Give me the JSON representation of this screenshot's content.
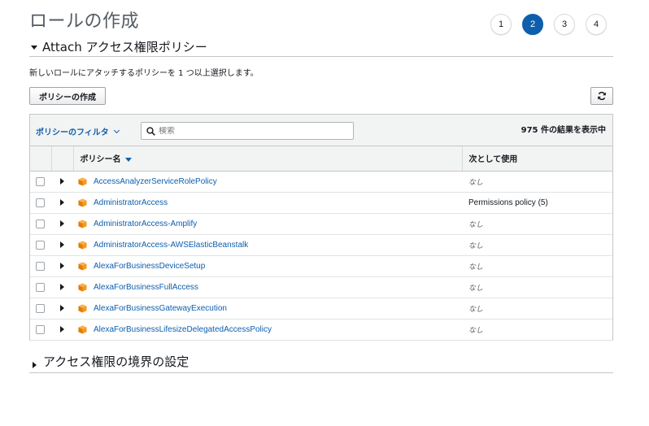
{
  "page": {
    "title": "ロールの作成",
    "steps": [
      "1",
      "2",
      "3",
      "4"
    ],
    "active_step": "2"
  },
  "section": {
    "title": "Attach アクセス権限ポリシー",
    "description": "新しいロールにアタッチするポリシーを 1 つ以上選択します。"
  },
  "toolbar": {
    "create_label": "ポリシーの作成"
  },
  "filter": {
    "label": "ポリシーのフィルタ",
    "search_placeholder": "検索",
    "result_count": "975 件の結果を表示中"
  },
  "table": {
    "headers": {
      "name": "ポリシー名",
      "used_as": "次として使用"
    },
    "rows": [
      {
        "name": "AccessAnalyzerServiceRolePolicy",
        "used_as": "なし"
      },
      {
        "name": "AdministratorAccess",
        "used_as": "Permissions policy (5)"
      },
      {
        "name": "AdministratorAccess-Amplify",
        "used_as": "なし"
      },
      {
        "name": "AdministratorAccess-AWSElasticBeanstalk",
        "used_as": "なし"
      },
      {
        "name": "AlexaForBusinessDeviceSetup",
        "used_as": "なし"
      },
      {
        "name": "AlexaForBusinessFullAccess",
        "used_as": "なし"
      },
      {
        "name": "AlexaForBusinessGatewayExecution",
        "used_as": "なし"
      },
      {
        "name": "AlexaForBusinessLifesizeDelegatedAccessPolicy",
        "used_as": "なし"
      }
    ]
  },
  "boundary_section": {
    "title": "アクセス権限の境界の設定"
  },
  "colors": {
    "accent": "#0d5fad",
    "policy_icon": "#f7981f"
  },
  "icons": {
    "refresh": "refresh-icon",
    "search": "search-icon",
    "policy": "policy-cube-icon"
  }
}
